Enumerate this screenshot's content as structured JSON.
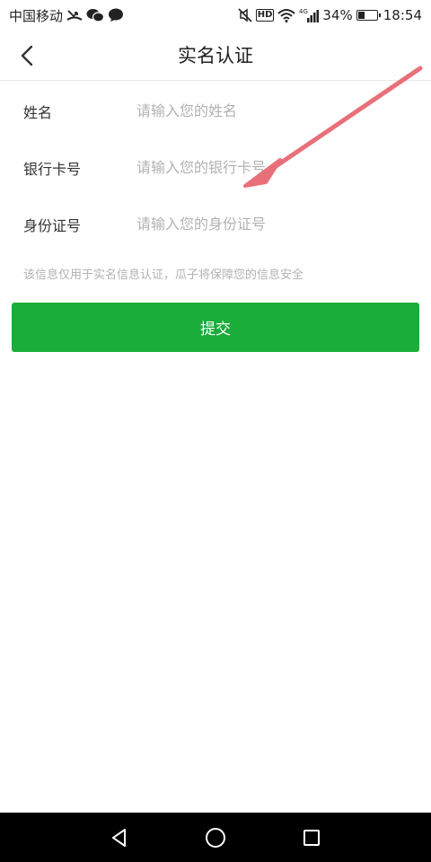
{
  "status_bar": {
    "carrier": "中国移动",
    "network": "4G",
    "battery_percent": "34%",
    "battery_level": 0.34,
    "time": "18:54",
    "hd_label": "HD",
    "icons": [
      "missed-call-icon",
      "wechat-icon",
      "message-icon",
      "mute-icon",
      "hd-icon",
      "wifi-icon",
      "signal-icon",
      "battery-icon"
    ]
  },
  "header": {
    "title": "实名认证",
    "back_icon": "chevron-left-icon"
  },
  "form": {
    "name": {
      "label": "姓名",
      "placeholder": "请输入您的姓名",
      "value": ""
    },
    "bank_card": {
      "label": "银行卡号",
      "placeholder": "请输入您的银行卡号",
      "value": ""
    },
    "id_number": {
      "label": "身份证号",
      "placeholder": "请输入您的身份证号",
      "value": ""
    },
    "notice": "该信息仅用于实名信息认证，瓜子将保障您的信息安全"
  },
  "submit": {
    "label": "提交"
  },
  "colors": {
    "accent": "#1aad3a",
    "annotation_arrow": "#e8707a",
    "placeholder": "#b2b2b2"
  },
  "system_nav": {
    "icons": [
      "back-triangle-icon",
      "home-circle-icon",
      "recents-square-icon"
    ]
  }
}
